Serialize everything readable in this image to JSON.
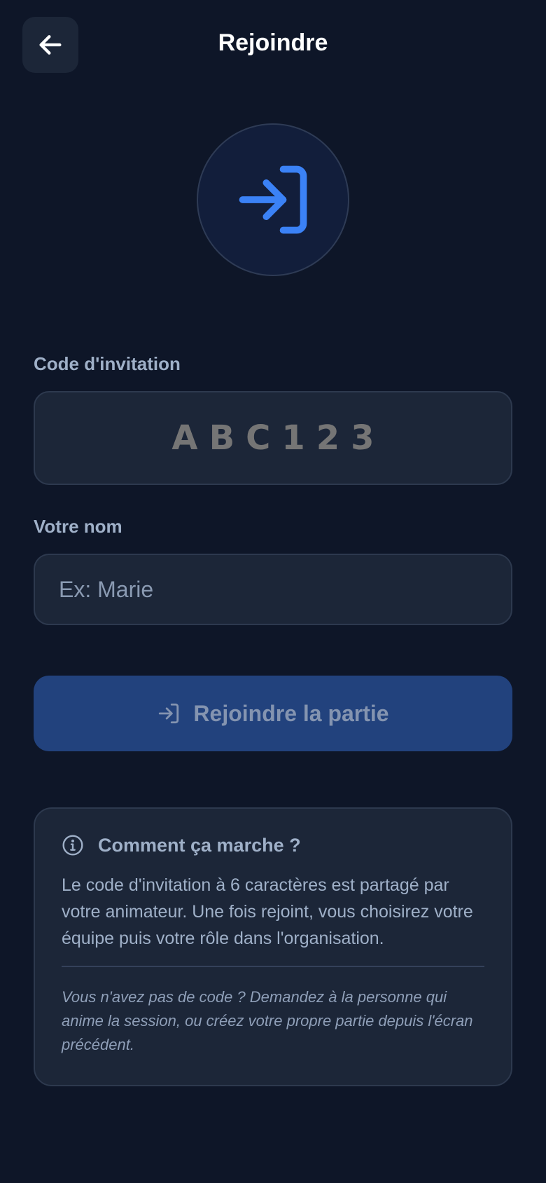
{
  "header": {
    "title": "Rejoindre",
    "back_icon": "arrow-left-icon"
  },
  "hero": {
    "icon": "log-in-icon",
    "accent": "#3b82f6"
  },
  "form": {
    "code_label": "Code d'invitation",
    "code_placeholder": "ABC123",
    "name_label": "Votre nom",
    "name_placeholder": "Ex: Marie"
  },
  "join_button": {
    "label": "Rejoindre la partie",
    "icon": "log-in-icon",
    "state": "disabled"
  },
  "info": {
    "icon": "info-icon",
    "title": "Comment ça marche ?",
    "text": "Le code d'invitation à 6 caractères est partagé par votre animateur. Une fois rejoint, vous choisirez votre équipe puis votre rôle dans l'organisation.",
    "note": "Vous n'avez pas de code ? Demandez à la personne qui anime la session, ou créez votre propre partie depuis l'écran précédent."
  }
}
